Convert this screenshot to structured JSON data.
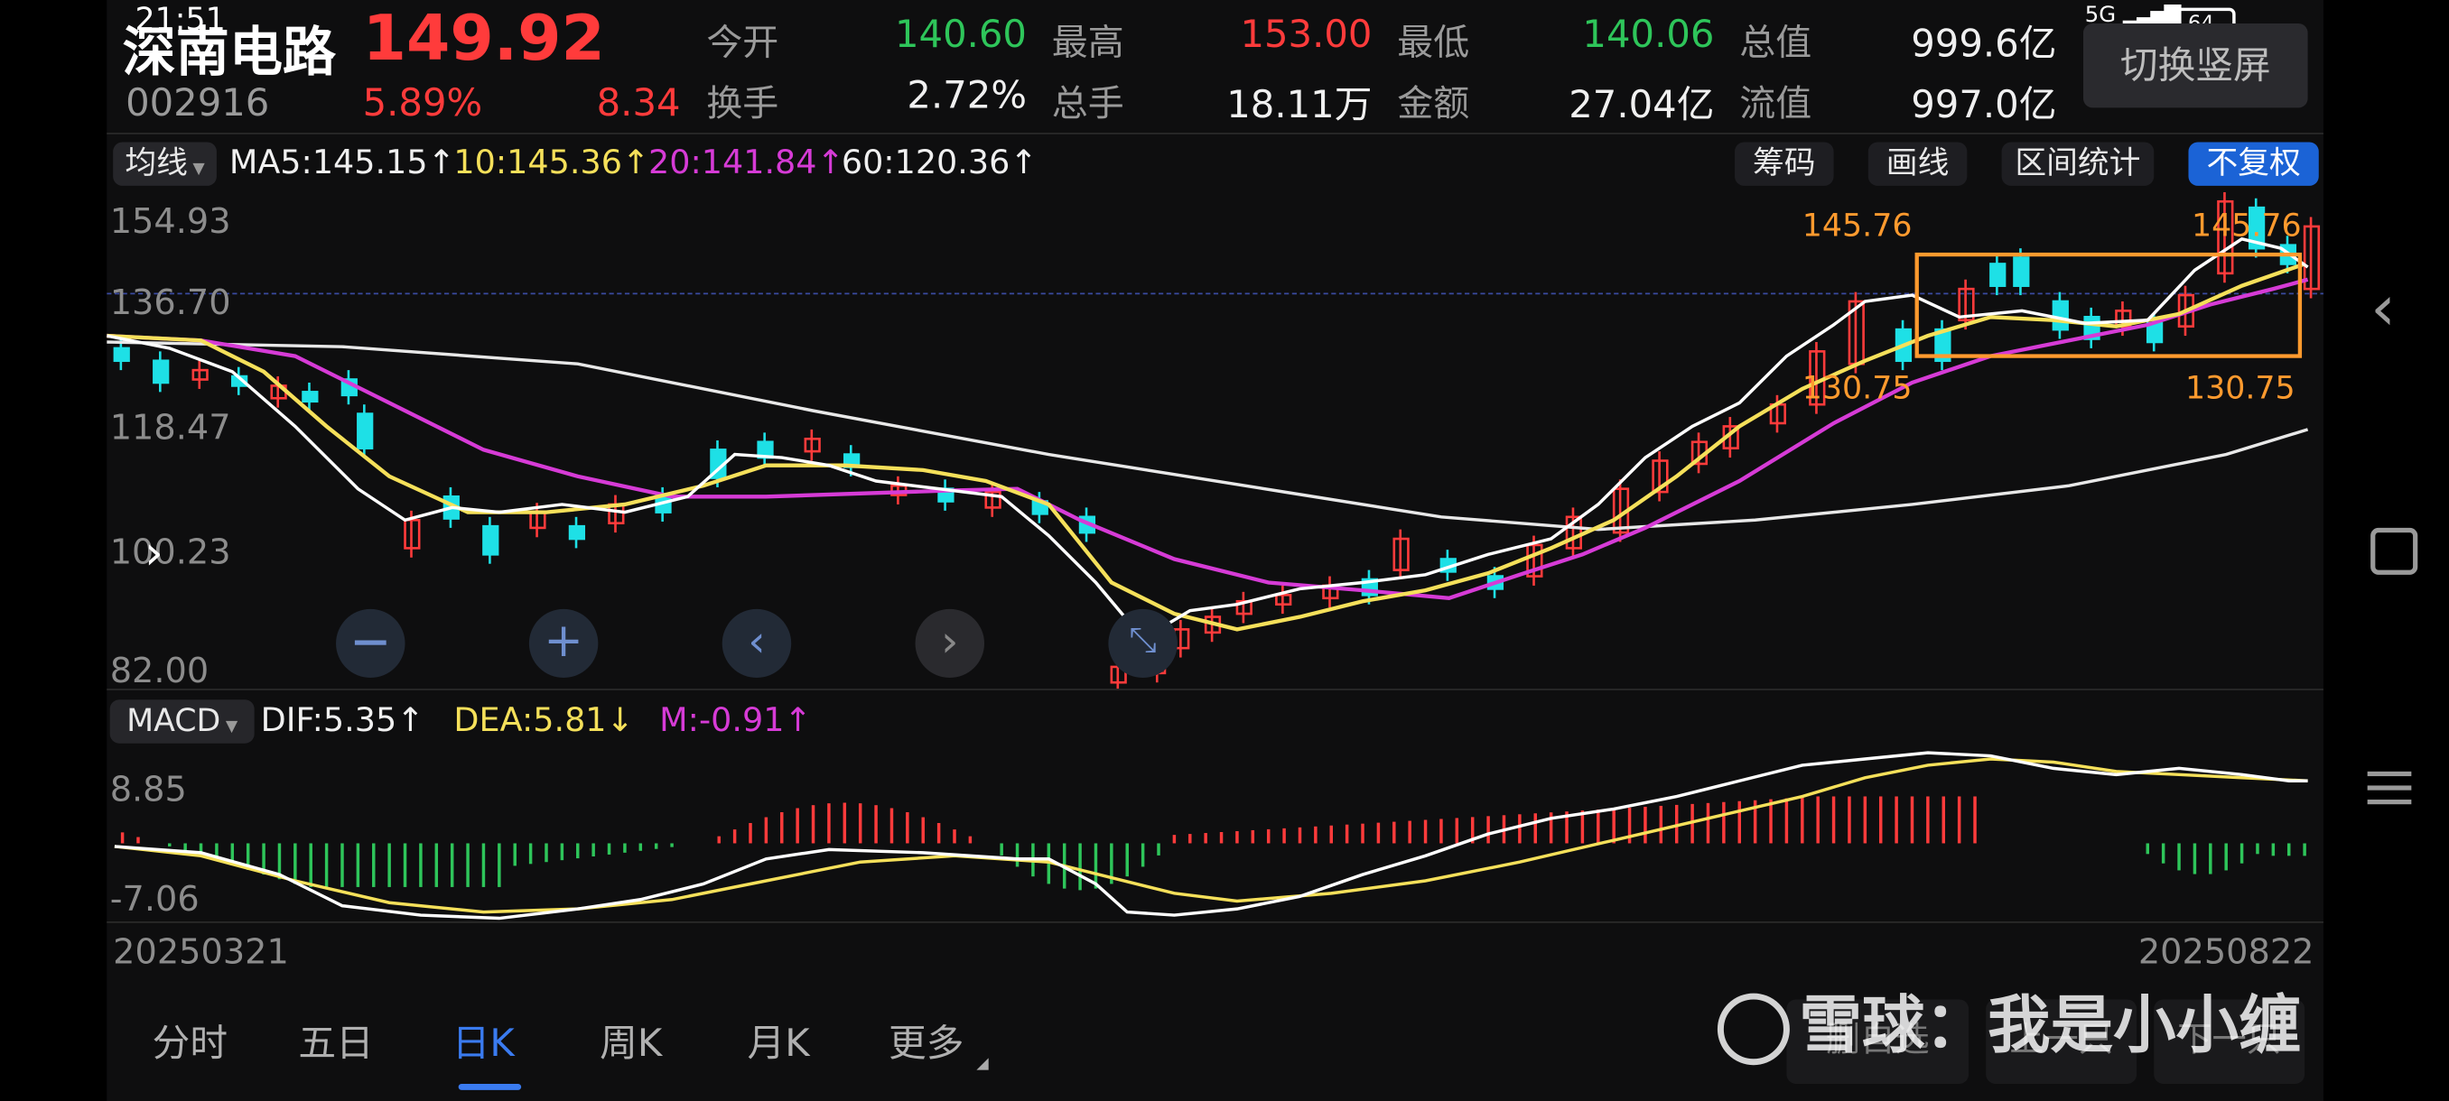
{
  "status_bar": {
    "time": "21:51",
    "network": "5G",
    "battery": "64"
  },
  "stock": {
    "name": "深南电路",
    "price": "149.92",
    "code": "002916",
    "change_pct": "5.89%",
    "change_abs": "8.34"
  },
  "stats": [
    {
      "label": "今开",
      "value": "140.60",
      "color": "green"
    },
    {
      "label": "最高",
      "value": "153.00",
      "color": "red"
    },
    {
      "label": "最低",
      "value": "140.06",
      "color": "green"
    },
    {
      "label": "总值",
      "value": "999.6亿",
      "color": "white"
    },
    {
      "label": "换手",
      "value": "2.72%",
      "color": "white"
    },
    {
      "label": "总手",
      "value": "18.11万",
      "color": "white"
    },
    {
      "label": "金额",
      "value": "27.04亿",
      "color": "white"
    },
    {
      "label": "流值",
      "value": "997.0亿",
      "color": "white"
    }
  ],
  "switch_button": "切换竖屏",
  "ma_bar": {
    "selector": "均线",
    "items": [
      {
        "text": "MA5:145.15↑",
        "color": "#f0f0f0"
      },
      {
        "text": "10:145.36↑",
        "color": "#f5e05a"
      },
      {
        "text": "20:141.84↑",
        "color": "#d63bd6"
      },
      {
        "text": "60:120.36↑",
        "color": "#f0f0f0"
      }
    ],
    "buttons": [
      "筹码",
      "画线",
      "区间统计"
    ],
    "active_button": "不复权"
  },
  "price_axis": [
    "154.93",
    "136.70",
    "118.47",
    "100.23",
    "82.00"
  ],
  "range_box": {
    "high": "145.76",
    "low": "130.75"
  },
  "macd_bar": {
    "selector": "MACD",
    "items": [
      {
        "text": "DIF:5.35↑",
        "color": "#f0f0f0"
      },
      {
        "text": "DEA:5.81↓",
        "color": "#f5e05a"
      },
      {
        "text": "M:-0.91↑",
        "color": "#d63bd6"
      }
    ]
  },
  "macd_axis": [
    "8.85",
    "-7.06"
  ],
  "date_axis": {
    "start": "20250321",
    "end": "20250822"
  },
  "tabs": [
    "分时",
    "五日",
    "日K",
    "周K",
    "月K",
    "更多"
  ],
  "active_tab": "日K",
  "bottom_buttons": [
    "删自选",
    "上一只",
    "下一只"
  ],
  "watermark": "雪球：我是小小缠",
  "colors": {
    "up": "#ff3b3b",
    "down": "#1ee0e6",
    "ma5": "#f0f0f0",
    "ma10": "#f5e05a",
    "ma20": "#d63bd6",
    "ma60": "#f0f0f0",
    "accent": "#1b63d6",
    "box": "#ff9a2e"
  },
  "chart_data": {
    "type": "candlestick",
    "x_range": [
      "20250321",
      "20250822"
    ],
    "ylim": [
      82.0,
      154.93
    ],
    "last_close": 149.92,
    "day_high": 153.0,
    "day_low": 140.06,
    "ma_last": {
      "MA5": 145.15,
      "MA10": 145.36,
      "MA20": 141.84,
      "MA60": 120.36
    },
    "macd_last": {
      "DIF": 5.35,
      "DEA": 5.81,
      "M": -0.91
    },
    "macd_ylim": [
      -7.06,
      8.85
    ]
  }
}
